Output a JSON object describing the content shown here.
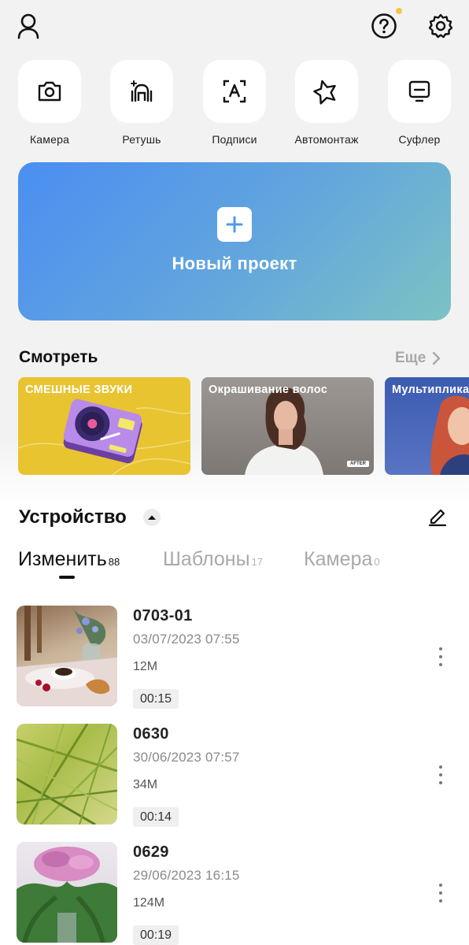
{
  "header": {
    "profile_icon": "person-icon",
    "help_icon": "question-circle-icon",
    "settings_icon": "gear-icon",
    "help_badge_color": "#f5c542"
  },
  "tools": [
    {
      "label": "Камера",
      "icon": "camera-icon"
    },
    {
      "label": "Ретушь",
      "icon": "retouch-icon"
    },
    {
      "label": "Подписи",
      "icon": "captions-icon"
    },
    {
      "label": "Автомонтаж",
      "icon": "sparkle-star-icon"
    },
    {
      "label": "Суфлер",
      "icon": "teleprompter-icon"
    }
  ],
  "new_project": {
    "label": "Новый проект",
    "gradient": [
      "#4a8ef2",
      "#7cc2c3"
    ]
  },
  "watch": {
    "title": "Смотреть",
    "more": "Еще",
    "cards": [
      {
        "label": "СМЕШНЫЕ ЗВУКИ",
        "bg": "#e8c431"
      },
      {
        "label": "Окрашивание волос",
        "bg": "#8f8a86",
        "tag": "AFTER"
      },
      {
        "label": "Мультипликация",
        "bg": "#3b5bb0"
      }
    ]
  },
  "device": {
    "title": "Устройство",
    "tabs": [
      {
        "label": "Изменить",
        "count": "88",
        "active": true
      },
      {
        "label": "Шаблоны",
        "count": "17",
        "active": false
      },
      {
        "label": "Камера",
        "count": "0",
        "active": false
      }
    ]
  },
  "projects": [
    {
      "name": "0703-01",
      "date": "03/07/2023 07:55",
      "size": "12M",
      "duration": "00:15"
    },
    {
      "name": "0630",
      "date": "30/06/2023 07:57",
      "size": "34M",
      "duration": "00:14"
    },
    {
      "name": "0629",
      "date": "29/06/2023 16:15",
      "size": "124M",
      "duration": "00:19"
    }
  ]
}
